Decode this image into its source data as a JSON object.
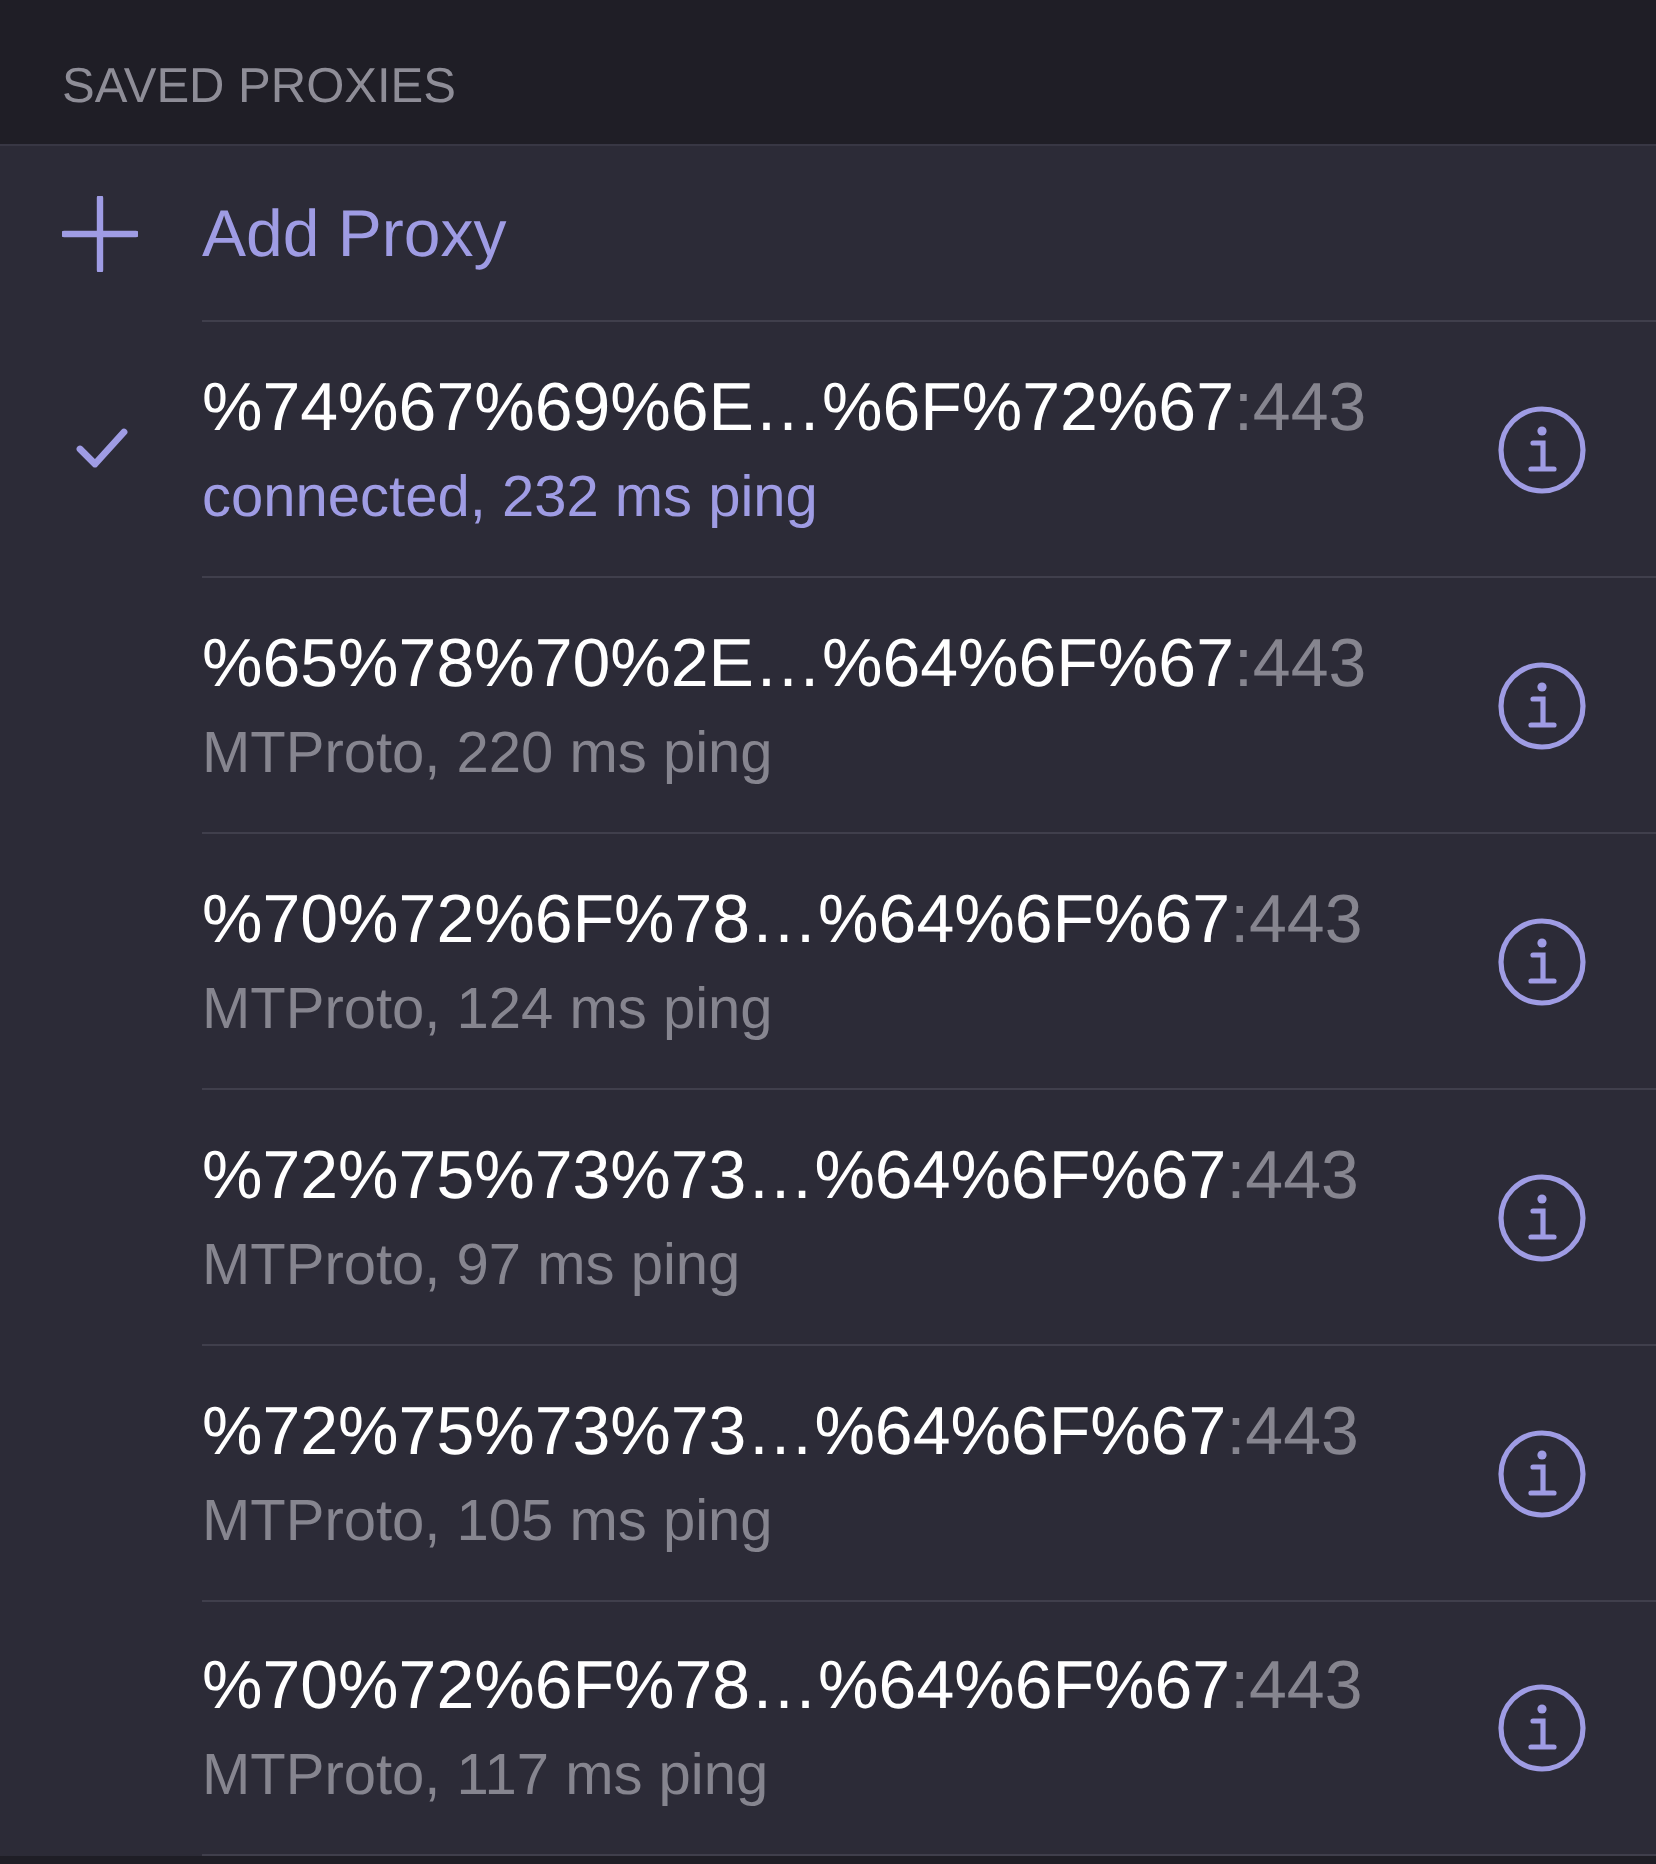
{
  "section": {
    "title": "SAVED PROXIES"
  },
  "add_proxy": {
    "label": "Add Proxy"
  },
  "proxies": [
    {
      "host": "%74%67%69%6E…%6F%72%67",
      "port": ":443",
      "status": "connected, 232 ms ping",
      "selected": true,
      "connected": true
    },
    {
      "host": "%65%78%70%2E…%64%6F%67",
      "port": ":443",
      "status": "MTProto, 220 ms ping",
      "selected": false,
      "connected": false
    },
    {
      "host": "%70%72%6F%78…%64%6F%67",
      "port": ":443",
      "status": "MTProto, 124 ms ping",
      "selected": false,
      "connected": false
    },
    {
      "host": "%72%75%73%73…%64%6F%67",
      "port": ":443",
      "status": "MTProto, 97 ms ping",
      "selected": false,
      "connected": false
    },
    {
      "host": "%72%75%73%73…%64%6F%67",
      "port": ":443",
      "status": "MTProto, 105 ms ping",
      "selected": false,
      "connected": false
    },
    {
      "host": "%70%72%6F%78…%64%6F%67",
      "port": ":443",
      "status": "MTProto, 117 ms ping",
      "selected": false,
      "connected": false
    }
  ]
}
